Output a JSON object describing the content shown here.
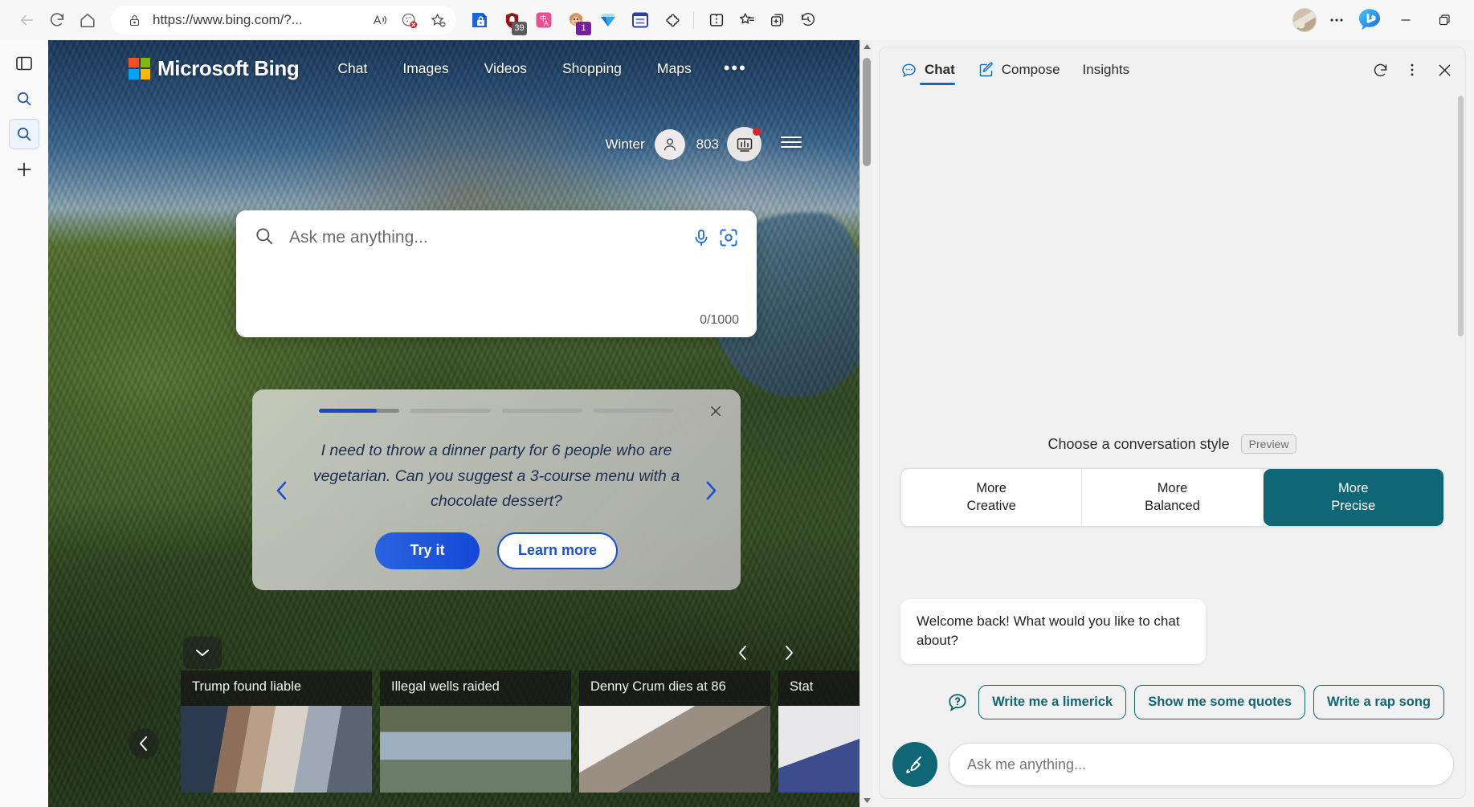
{
  "browser": {
    "url": "https://www.bing.com/?...",
    "back_label": "Back",
    "refresh_label": "Refresh",
    "home_label": "Home",
    "lock_icon": "lock-icon",
    "read_aloud_icon": "read-aloud-icon",
    "cookie_icon": "cookie-blocked-icon",
    "favorite_icon": "add-favorite-icon",
    "extensions": [
      {
        "name": "enterprise-protect-icon",
        "badge": "",
        "badge_color": ""
      },
      {
        "name": "ublock-origin-icon",
        "badge": "39",
        "badge_color": "#5b5b5b"
      },
      {
        "name": "translate-icon",
        "badge": "",
        "badge_color": ""
      },
      {
        "name": "tampermonkey-icon",
        "badge": "1",
        "badge_color": "#7a1ea1"
      },
      {
        "name": "diamond-icon",
        "badge": "",
        "badge_color": ""
      },
      {
        "name": "form-filler-icon",
        "badge": "",
        "badge_color": ""
      },
      {
        "name": "puzzle-extensions-icon",
        "badge": "",
        "badge_color": ""
      }
    ],
    "split_screen_label": "Split screen",
    "favorites_label": "Favorites",
    "collections_label": "Collections",
    "history_label": "History",
    "profile_label": "Profile",
    "settings_more_label": "Settings and more",
    "bing_chat_label": "Bing Chat",
    "minimize_label": "Minimize",
    "restore_label": "Restore"
  },
  "left_rail": {
    "items": [
      {
        "name": "sidebar-toggle-icon",
        "label": "Toggle sidebar"
      },
      {
        "name": "discover-search-icon",
        "label": "Search"
      },
      {
        "name": "bing-search-icon",
        "label": "Bing search"
      },
      {
        "name": "add-tool-icon",
        "label": "Add"
      }
    ]
  },
  "bing": {
    "brand": "Microsoft Bing",
    "nav": [
      "Chat",
      "Images",
      "Videos",
      "Shopping",
      "Maps"
    ],
    "nav_more": "•••",
    "user_name": "Winter",
    "rewards_points": "803",
    "search_placeholder": "Ask me anything...",
    "search_value": "",
    "char_counter": "0/1000",
    "mic_icon": "microphone-icon",
    "camera_icon": "visual-search-icon",
    "suggestion": {
      "text": "I need to throw a dinner party for 6 people who are vegetarian. Can you suggest a 3-course menu with a chocolate dessert?",
      "try_label": "Try it",
      "learn_label": "Learn more",
      "close_icon": "close-icon",
      "prev_icon": "chevron-left-icon",
      "next_icon": "chevron-right-icon",
      "dot_count": 4,
      "active_dot": 0
    },
    "news": [
      {
        "title": "Trump found liable"
      },
      {
        "title": "Illegal wells raided"
      },
      {
        "title": "Denny Crum dies at 86"
      },
      {
        "title": "Stat"
      }
    ],
    "news_prev_icon": "chevron-left-icon",
    "news_next_icon": "chevron-right-icon",
    "scroll_down_icon": "chevron-down-icon"
  },
  "chat": {
    "tabs": [
      {
        "label": "Chat",
        "icon": "chat-bubble-icon",
        "active": true
      },
      {
        "label": "Compose",
        "icon": "compose-pencil-icon",
        "active": false
      },
      {
        "label": "Insights",
        "icon": "",
        "active": false
      }
    ],
    "refresh_icon": "refresh-icon",
    "more_icon": "more-options-icon",
    "close_icon": "close-icon",
    "tone": {
      "label": "Choose a conversation style",
      "preview_badge": "Preview",
      "options": [
        {
          "line1": "More",
          "line2": "Creative",
          "selected": false
        },
        {
          "line1": "More",
          "line2": "Balanced",
          "selected": false
        },
        {
          "line1": "More",
          "line2": "Precise",
          "selected": true
        }
      ]
    },
    "bot_message": "Welcome back! What would you like to chat about?",
    "chips": [
      "Write me a limerick",
      "Show me some quotes",
      "Write a rap song"
    ],
    "help_icon": "help-bubble-icon",
    "sweep_icon": "new-topic-broom-icon",
    "input_placeholder": "Ask me anything...",
    "input_value": ""
  },
  "colors": {
    "accent_blue": "#0f6cbd",
    "teal": "#0f6674",
    "bing_blue": "#1a4fd6",
    "badge_red": "#d9262b"
  }
}
